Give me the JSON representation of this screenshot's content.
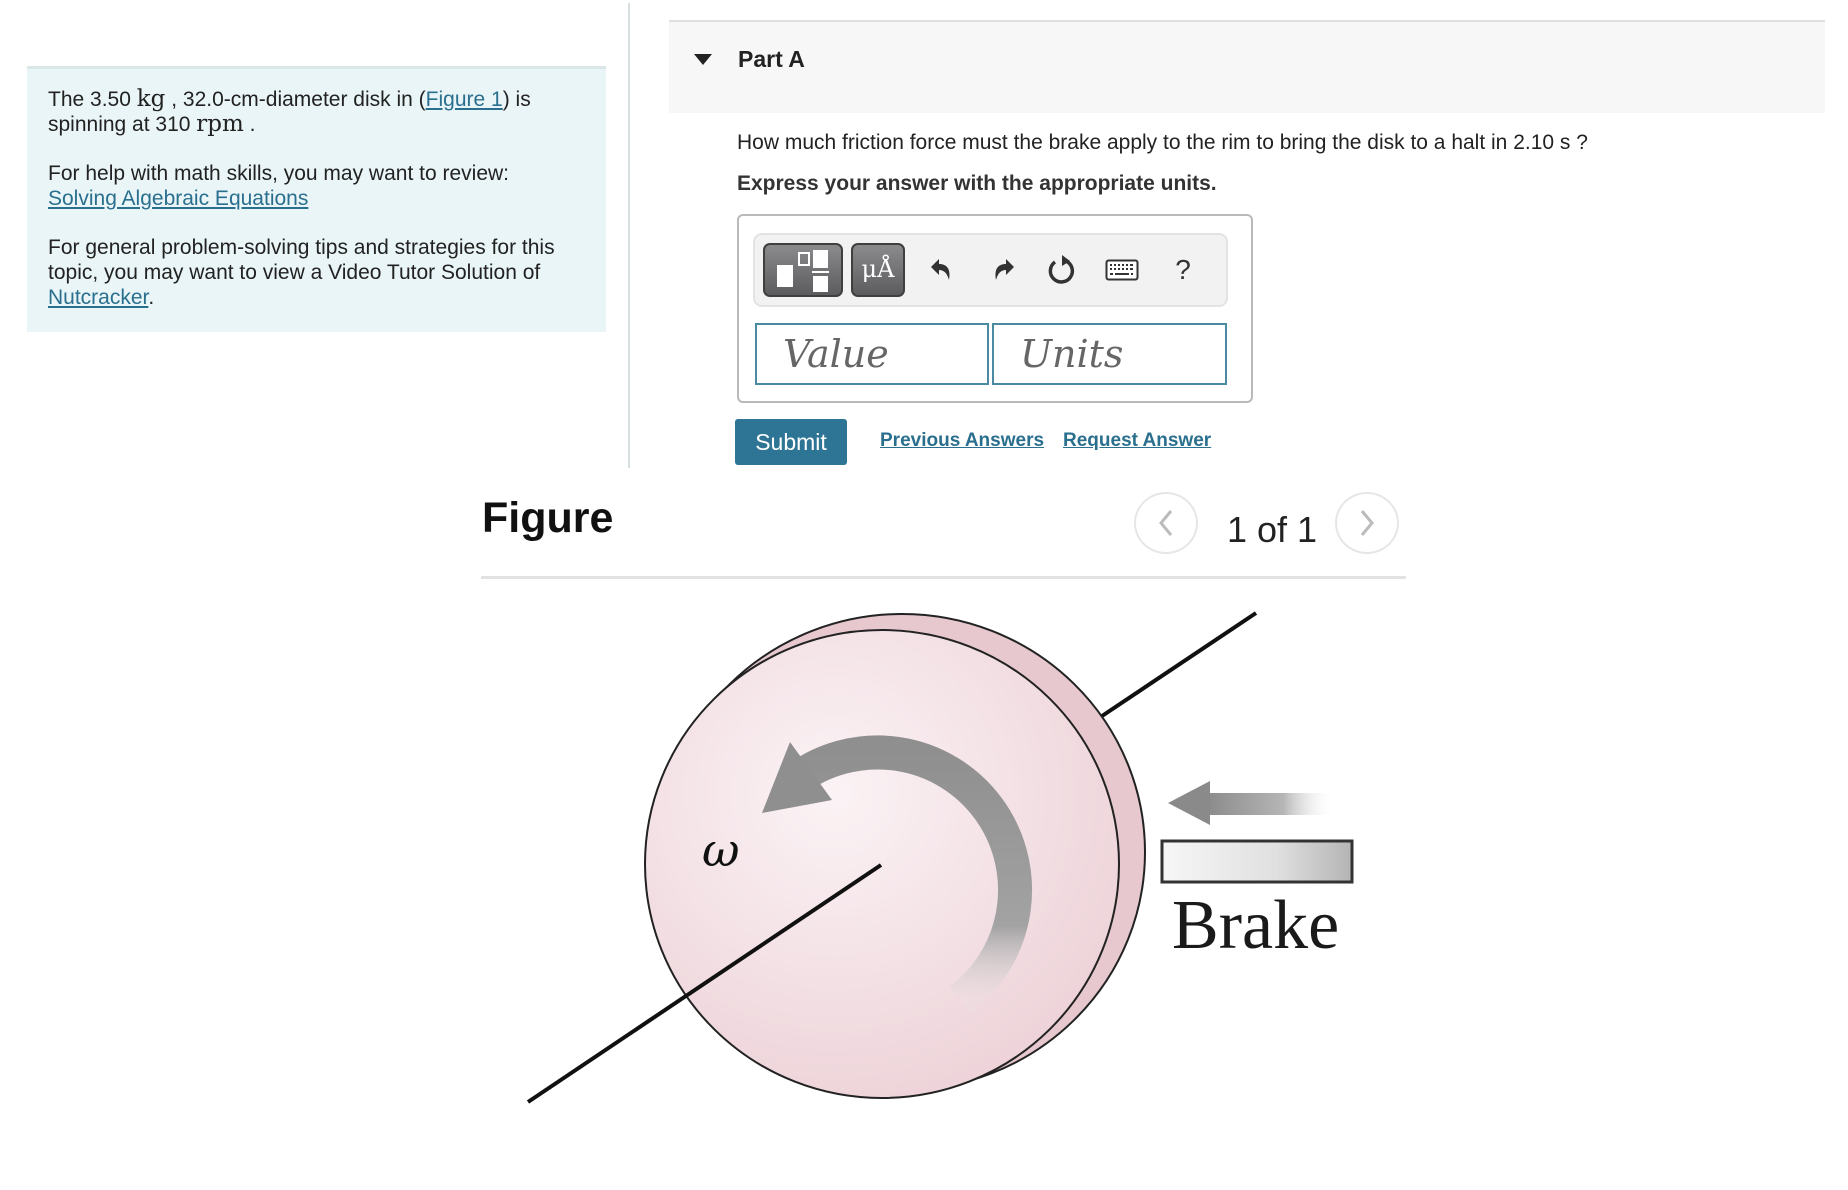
{
  "problem": {
    "intro_prefix": "The 3.50 ",
    "mass_unit": "kg",
    "intro_middle": " , 32.0-cm-diameter disk in (",
    "figure_link": "Figure 1",
    "intro_suffix": ") is spinning at 310 ",
    "speed_unit": "rpm",
    "intro_end": " .",
    "help_text": "For help with math skills, you may want to review:",
    "help_link": "Solving Algebraic Equations",
    "tips_text": "For general problem-solving tips and strategies for this topic, you may want to view a Video Tutor Solution of ",
    "tips_link": "Nutcracker",
    "tips_end": "."
  },
  "part": {
    "title": "Part A",
    "question": "How much friction force must the brake apply to the rim to bring the disk to a halt in 2.10 s ?",
    "instruction": "Express your answer with the appropriate units."
  },
  "toolbar": {
    "templates_icon": "templates-icon",
    "units_label": "μÅ",
    "undo_icon": "undo-icon",
    "redo_icon": "redo-icon",
    "reset_icon": "reset-icon",
    "keyboard_icon": "keyboard-icon",
    "help_label": "?"
  },
  "answer": {
    "value": "",
    "value_placeholder": "Value",
    "units": "",
    "units_placeholder": "Units"
  },
  "actions": {
    "submit": "Submit",
    "previous_answers": "Previous Answers",
    "request_answer": "Request Answer"
  },
  "figure": {
    "title": "Figure",
    "pager": "1 of 1",
    "omega_label": "ω",
    "brake_label": "Brake"
  },
  "colors": {
    "accent": "#2e7494",
    "link": "#2a6f8e",
    "info_bg": "#e9f5f7",
    "disk_fill": "#f3dde1"
  }
}
